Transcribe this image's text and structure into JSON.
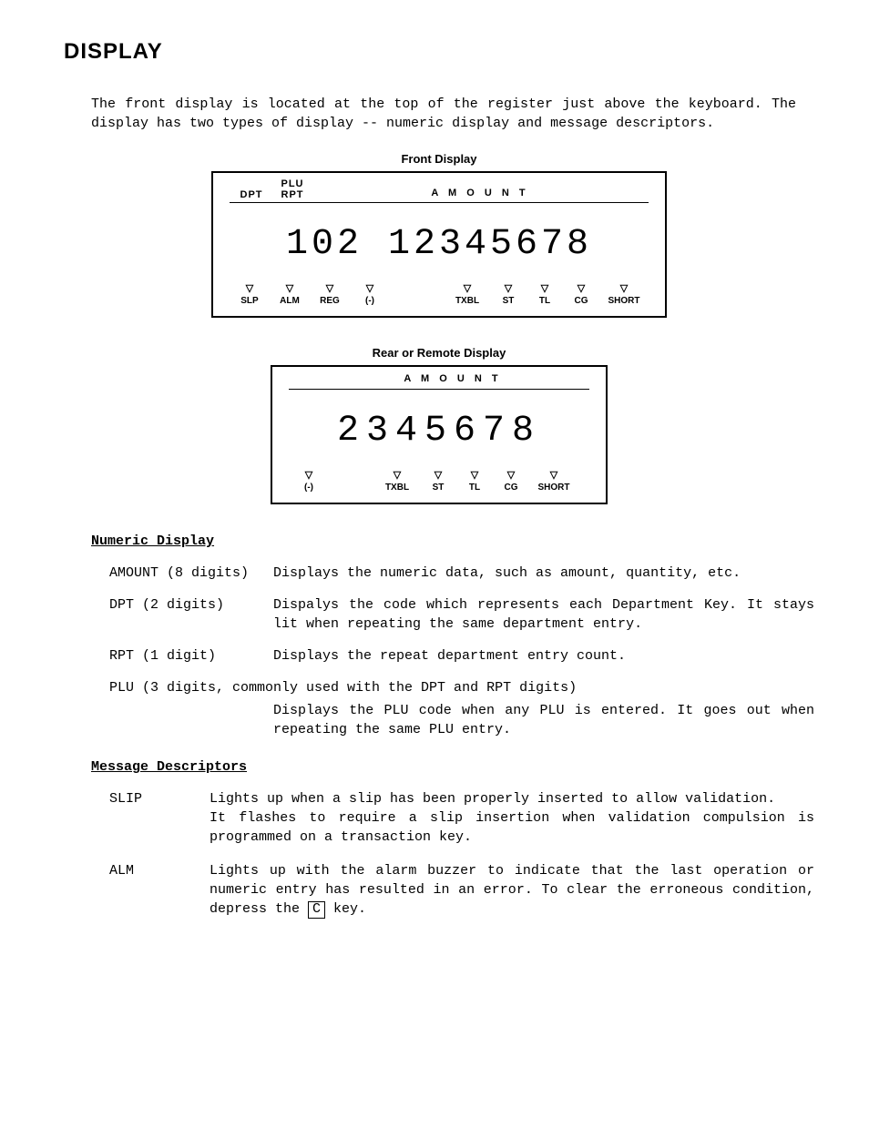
{
  "title": "DISPLAY",
  "intro": "The front display is located at the top of the register just above the keyboard.  The display has two types of display -- numeric display and message descriptors.",
  "front": {
    "caption": "Front Display",
    "header": {
      "plu": "PLU",
      "dpt": "DPT",
      "rpt": "RPT",
      "amount": "A M O U N T"
    },
    "digits": "102 12345678",
    "indicators": [
      {
        "sym": "▽",
        "lbl": "SLP"
      },
      {
        "sym": "▽",
        "lbl": "ALM"
      },
      {
        "sym": "▽",
        "lbl": "REG"
      },
      {
        "sym": "▽",
        "lbl": "(-)"
      },
      {
        "sym": "",
        "lbl": ""
      },
      {
        "sym": "▽",
        "lbl": "TXBL"
      },
      {
        "sym": "▽",
        "lbl": "ST"
      },
      {
        "sym": "▽",
        "lbl": "TL"
      },
      {
        "sym": "▽",
        "lbl": "CG"
      },
      {
        "sym": "▽",
        "lbl": "SHORT"
      }
    ]
  },
  "rear": {
    "caption": "Rear or Remote Display",
    "header": {
      "amount": "A M O U N T"
    },
    "digits": "2345678",
    "indicators": [
      {
        "sym": "▽",
        "lbl": "(-)"
      },
      {
        "sym": "",
        "lbl": ""
      },
      {
        "sym": "▽",
        "lbl": "TXBL"
      },
      {
        "sym": "▽",
        "lbl": "ST"
      },
      {
        "sym": "▽",
        "lbl": "TL"
      },
      {
        "sym": "▽",
        "lbl": "CG"
      },
      {
        "sym": "▽",
        "lbl": "SHORT"
      }
    ]
  },
  "numeric": {
    "heading": "Numeric Display",
    "rows": [
      {
        "term": "AMOUNT (8 digits)",
        "desc": "Displays the numeric data, such as amount, quantity, etc."
      },
      {
        "term": "DPT (2 digits)",
        "desc": "Dispalys the code which represents each Department Key. It stays lit when repeating the same department entry."
      },
      {
        "term": "RPT (1 digit)",
        "desc": "Displays the repeat department entry count."
      }
    ],
    "plu_term": "PLU (3 digits, commonly used with the DPT and RPT digits)",
    "plu_desc": "Displays the PLU code when any PLU is entered.  It goes out when repeating the same PLU entry."
  },
  "message": {
    "heading": "Message Descriptors",
    "rows": [
      {
        "term": "SLIP",
        "desc": "Lights up when a slip has been properly inserted to allow validation.\nIt flashes to require a slip insertion when validation compulsion is programmed on a transaction key."
      },
      {
        "term": "ALM",
        "desc_pre": "Lights up with the alarm buzzer to indicate that the last operation or numeric entry has resulted in an error.  To clear the erroneous condition, depress the ",
        "key": "C",
        "desc_post": " key."
      }
    ]
  }
}
